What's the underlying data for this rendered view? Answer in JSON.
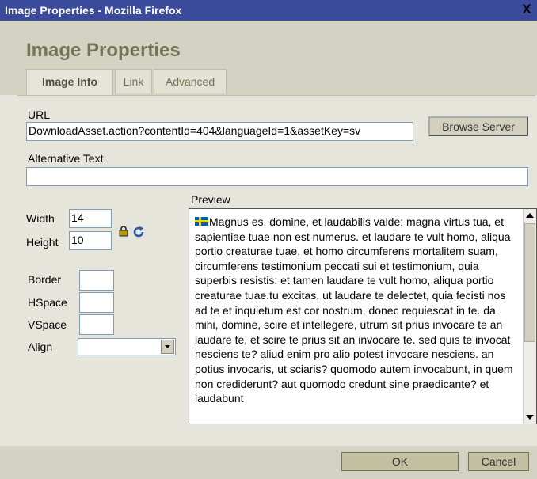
{
  "window": {
    "title": "Image Properties - Mozilla Firefox",
    "close_label": "X"
  },
  "header": {
    "title": "Image Properties"
  },
  "tabs": [
    {
      "label": "Image Info",
      "active": true
    },
    {
      "label": "Link",
      "active": false
    },
    {
      "label": "Advanced",
      "active": false
    }
  ],
  "url": {
    "label": "URL",
    "value": "DownloadAsset.action?contentId=404&languageId=1&assetKey=sv",
    "browse_label": "Browse Server"
  },
  "alt": {
    "label": "Alternative Text",
    "value": ""
  },
  "dimensions": {
    "width_label": "Width",
    "width_value": "14",
    "height_label": "Height",
    "height_value": "10"
  },
  "spacing": {
    "border_label": "Border",
    "border_value": "",
    "hspace_label": "HSpace",
    "hspace_value": "",
    "vspace_label": "VSpace",
    "vspace_value": "",
    "align_label": "Align",
    "align_value": ""
  },
  "preview": {
    "label": "Preview",
    "text": "Magnus es, domine, et laudabilis valde: magna virtus tua, et sapientiae tuae non est numerus. et laudare te vult homo, aliqua portio creaturae tuae, et homo circumferens mortalitem suam, circumferens testimonium peccati sui et testimonium, quia superbis resistis: et tamen laudare te vult homo, aliqua portio creaturae tuae.tu excitas, ut laudare te delectet, quia fecisti nos ad te et inquietum est cor nostrum, donec requiescat in te. da mihi, domine, scire et intellegere, utrum sit prius invocare te an laudare te, et scire te prius sit an invocare te. sed quis te invocat nesciens te? aliud enim pro alio potest invocare nesciens. an potius invocaris, ut sciaris? quomodo autem invocabunt, in quem non crediderunt? aut quomodo credunt sine praedicante? et laudabunt"
  },
  "footer": {
    "ok_label": "OK",
    "cancel_label": "Cancel"
  },
  "colors": {
    "titlebar": "#3a4b9c",
    "header_bg": "#d3d2c3",
    "body_bg": "#e6e5dc",
    "heading": "#737357"
  }
}
